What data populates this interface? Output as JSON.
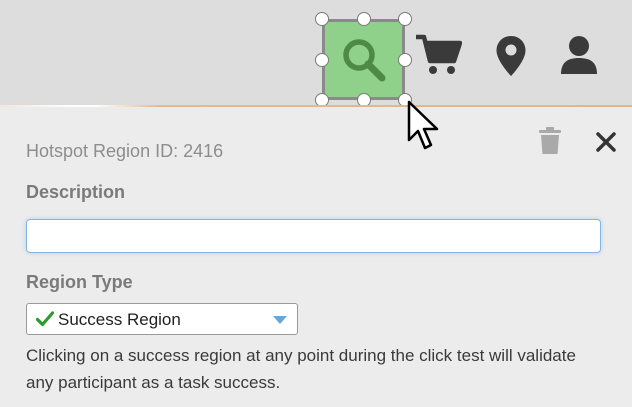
{
  "toolbar": {
    "icons": [
      "search-icon",
      "cart-icon",
      "location-pin-icon",
      "user-icon"
    ],
    "hotspot_fill": "#8fd18a",
    "hotspot_icon_color": "#4e8a44"
  },
  "panel": {
    "region_id_label": "Hotspot Region ID: 2416",
    "description_label": "Description",
    "description_value": "",
    "region_type_label": "Region Type",
    "region_type_value": "Success Region",
    "help_text": "Clicking on a success region at any point during the click test will validate any participant as a task success.",
    "actions": [
      "trash-icon",
      "close-icon"
    ]
  },
  "colors": {
    "check": "#2e9b2e",
    "dropdown_arrow": "#6aa6d6",
    "input_border": "#82b4e6"
  }
}
